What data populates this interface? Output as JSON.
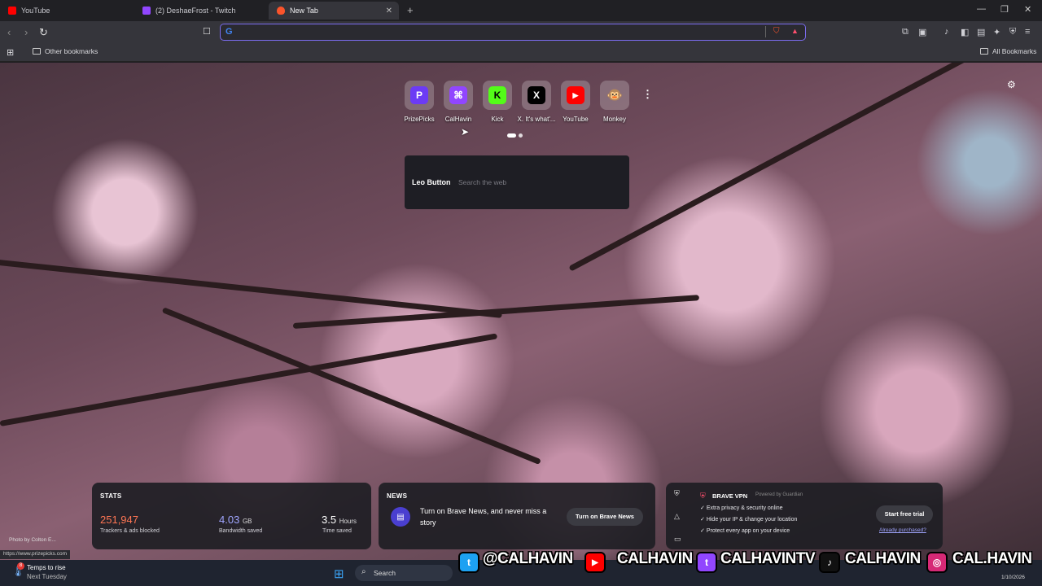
{
  "tabs": [
    {
      "title": "YouTube",
      "color": "#ff0000"
    },
    {
      "title": "(2) DeshaeFrost - Twitch",
      "color": "#9146ff"
    },
    {
      "title": "New Tab",
      "color": "#fb542b"
    }
  ],
  "bookmarks": {
    "left": "Other bookmarks",
    "right": "All Bookmarks"
  },
  "top_sites": [
    {
      "label": "PrizePicks",
      "glyph": "P",
      "color": "#6c3bf5"
    },
    {
      "label": "CalHavin",
      "glyph": "⌘",
      "color": "#9146ff"
    },
    {
      "label": "Kick",
      "glyph": "K",
      "color": "#53fc18"
    },
    {
      "label": "X. It's what'...",
      "glyph": "X",
      "color": "#000000"
    },
    {
      "label": "YouTube",
      "glyph": "▶",
      "color": "#ff0000"
    },
    {
      "label": "Monkey",
      "glyph": "🐵",
      "color": "#c9a57a"
    }
  ],
  "leo": {
    "name": "Leo Button",
    "placeholder": "Search the web"
  },
  "stats": {
    "heading": "STATS",
    "trackers_value": "251,947",
    "trackers_caption": "Trackers & ads blocked",
    "bandwidth_value": "4.03",
    "bandwidth_unit": "GB",
    "bandwidth_caption": "Bandwidth saved",
    "time_value": "3.5",
    "time_unit": "Hours",
    "time_caption": "Time saved"
  },
  "news": {
    "heading": "NEWS",
    "message": "Turn on Brave News, and never miss a story",
    "button": "Turn on Brave News"
  },
  "vpn": {
    "title": "BRAVE VPN",
    "powered": "Powered by",
    "partner": "Guardian",
    "features": [
      "Extra privacy & security online",
      "Hide your IP & change your location",
      "Protect every app on your device"
    ],
    "trial_button": "Start free trial",
    "purchased_link": "Already purchased?"
  },
  "photo_credit": "Photo by Colton E...",
  "status_url": "https://www.prizepicks.com",
  "weather": {
    "badge": "8",
    "line1": "Temps to rise",
    "line2": "Next Tuesday"
  },
  "taskbar_search": "Search",
  "clock_date": "1/10/2026",
  "socials": [
    {
      "name": "@CALHAVIN",
      "color": "#1da1f2"
    },
    {
      "name": "CALHAVIN",
      "color": "#ff0000"
    },
    {
      "name": "CALHAVINTV",
      "color": "#9146ff"
    },
    {
      "name": "CALHAVIN",
      "color": "#111111"
    },
    {
      "name": "CAL.HAVIN",
      "color": "#d62976"
    }
  ]
}
